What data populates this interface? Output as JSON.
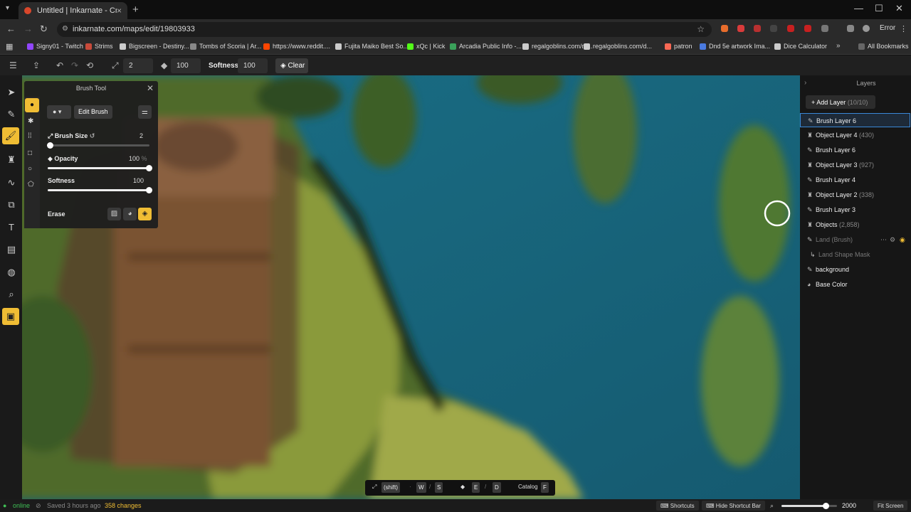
{
  "browser": {
    "tab_title": "Untitled | Inkarnate - Create Fa",
    "tab_close": "×",
    "new_tab": "+",
    "url": "inkarnate.com/maps/edit/19803933",
    "error_label": "Error",
    "bookmarks": [
      {
        "label": "Signy01 - Twitch",
        "color": "#9146ff"
      },
      {
        "label": "Strims",
        "color": "#c84a3a"
      },
      {
        "label": "Bigscreen - Destiny...",
        "color": "#cccccc"
      },
      {
        "label": "Tombs of Scoria | Ar...",
        "color": "#888888"
      },
      {
        "label": "https://www.reddit....",
        "color": "#ff4500"
      },
      {
        "label": "Fujita Maiko Best So...",
        "color": "#cccccc"
      },
      {
        "label": "xQc | Kick",
        "color": "#53fc18"
      },
      {
        "label": "Arcadia Public Info -...",
        "color": "#3aa15a"
      },
      {
        "label": "regalgoblins.com/m...",
        "color": "#cccccc"
      },
      {
        "label": "regalgoblins.com/d...",
        "color": "#cccccc"
      },
      {
        "label": "patron",
        "color": "#f96854"
      },
      {
        "label": "Dnd 5e artwork Ima...",
        "color": "#4a7ae0"
      },
      {
        "label": "Dice Calculator",
        "color": "#cccccc"
      }
    ],
    "all_bookmarks": "All Bookmarks"
  },
  "toolbar": {
    "size_value": "2",
    "opacity_value": "100",
    "softness_label": "Softness:",
    "softness_value": "100",
    "clear_label": "Clear"
  },
  "brush_panel": {
    "title": "Brush Tool",
    "edit_brush": "Edit Brush",
    "brush_size_label": "Brush Size",
    "brush_size_value": "2",
    "brush_size_level": 0.03,
    "opacity_label": "Opacity",
    "opacity_value": "100",
    "opacity_unit": "%",
    "opacity_level": 1.0,
    "softness_label": "Softness",
    "softness_value": "100",
    "softness_level": 1.0,
    "erase_label": "Erase"
  },
  "layers": {
    "title": "Layers",
    "add_layer": "Add Layer",
    "add_layer_count": "(10/10)",
    "items": [
      {
        "icon": "brush",
        "name": "Brush Layer 6",
        "count": "",
        "state": "selected"
      },
      {
        "icon": "object",
        "name": "Object Layer 4",
        "count": "(430)",
        "state": ""
      },
      {
        "icon": "brush",
        "name": "Brush Layer 6",
        "count": "",
        "state": ""
      },
      {
        "icon": "object",
        "name": "Object Layer 3",
        "count": "(927)",
        "state": ""
      },
      {
        "icon": "brush",
        "name": "Brush Layer 4",
        "count": "",
        "state": ""
      },
      {
        "icon": "object",
        "name": "Object Layer 2",
        "count": "(338)",
        "state": ""
      },
      {
        "icon": "brush",
        "name": "Brush Layer 3",
        "count": "",
        "state": ""
      },
      {
        "icon": "object",
        "name": "Objects",
        "count": "(2,858)",
        "state": ""
      },
      {
        "icon": "brush",
        "name": "Land (Brush)",
        "count": "",
        "state": "hidden"
      },
      {
        "icon": "mask",
        "name": "Land Shape Mask",
        "count": "",
        "state": "mask"
      },
      {
        "icon": "brush",
        "name": "background",
        "count": "",
        "state": ""
      },
      {
        "icon": "palette",
        "name": "Base Color",
        "count": "",
        "state": ""
      }
    ]
  },
  "shortcut_bar": {
    "shift": "(shift)",
    "keys": [
      "W",
      "S",
      "E",
      "D"
    ],
    "catalog": "Catalog",
    "catalog_key": "F"
  },
  "status": {
    "online": "online",
    "saved": "Saved 3 hours ago",
    "changes": "358 changes",
    "shortcuts": "Shortcuts",
    "hide_shortcut_bar": "Hide Shortcut Bar",
    "zoom_value": "2000",
    "zoom_level": 0.8,
    "fit_screen": "Fit Screen"
  },
  "colors": {
    "accent": "#f0bd34",
    "selection": "#3a88d8",
    "water": "#1e6d80"
  }
}
